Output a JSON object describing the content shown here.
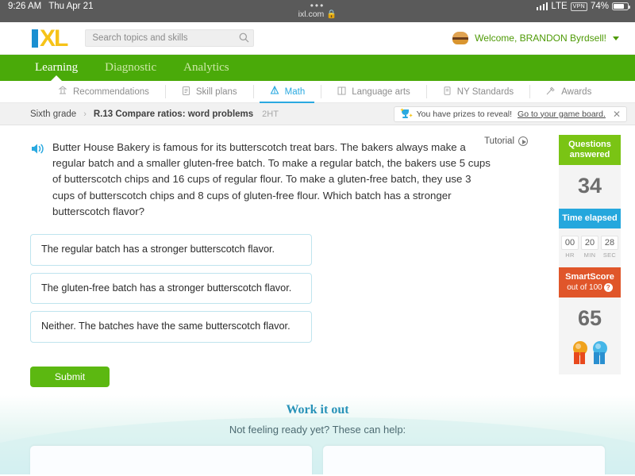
{
  "status_bar": {
    "time": "9:26 AM",
    "date": "Thu Apr 21",
    "url": "ixl.com",
    "lock_icon": "lock-icon",
    "network": "LTE",
    "vpn": "VPN",
    "battery_percent": "74%"
  },
  "header": {
    "logo": {
      "i": "I",
      "x": "X",
      "l": "L"
    },
    "search": {
      "placeholder": "Search topics and skills",
      "value": ""
    },
    "welcome_text": "Welcome, BRANDON Byrdsell!"
  },
  "green_nav": [
    {
      "label": "Learning",
      "active": true
    },
    {
      "label": "Diagnostic",
      "active": false
    },
    {
      "label": "Analytics",
      "active": false
    }
  ],
  "sub_nav": [
    {
      "label": "Recommendations",
      "icon": "recommendations-icon",
      "active": false
    },
    {
      "label": "Skill plans",
      "icon": "clipboard-icon",
      "active": false
    },
    {
      "label": "Math",
      "icon": "math-pyramid-icon",
      "active": true
    },
    {
      "label": "Language arts",
      "icon": "book-icon",
      "active": false
    },
    {
      "label": "NY Standards",
      "icon": "standards-icon",
      "active": false
    },
    {
      "label": "Awards",
      "icon": "awards-icon",
      "active": false
    }
  ],
  "breadcrumb": {
    "grade": "Sixth grade",
    "separator": "›",
    "skill": "R.13 Compare ratios: word problems",
    "code": "2HT"
  },
  "prize_banner": {
    "message": "You have prizes to reveal!",
    "link": "Go to your game board.",
    "close": "✕"
  },
  "tutorial": {
    "label": "Tutorial"
  },
  "question": {
    "text": "Butter House Bakery is famous for its butterscotch treat bars. The bakers always make a regular batch and a smaller gluten-free batch. To make a regular batch, the bakers use 5 cups of butterscotch chips and 16 cups of regular flour. To make a gluten-free batch, they use 3 cups of butterscotch chips and 8 cups of gluten-free flour. Which batch has a stronger butterscotch flavor?",
    "answers": [
      "The regular batch has a stronger butterscotch flavor.",
      "The gluten-free batch has a stronger butterscotch flavor.",
      "Neither. The batches have the same butterscotch flavor."
    ],
    "submit_label": "Submit"
  },
  "rail": {
    "questions_answered": {
      "title": "Questions answered",
      "value": "34"
    },
    "time_elapsed": {
      "title": "Time elapsed",
      "hr": "00",
      "min": "20",
      "sec": "28",
      "hr_label": "HR",
      "min_label": "MIN",
      "sec_label": "SEC"
    },
    "smartscore": {
      "title": "SmartScore",
      "subtitle": "out of 100",
      "value": "65"
    }
  },
  "work_it_out": {
    "title": "Work it out",
    "subtitle": "Not feeling ready yet? These can help:"
  },
  "colors": {
    "green": "#4aaa09",
    "submit_green": "#5cb811",
    "blue": "#2aa9e0",
    "orange": "#e0562a",
    "score_green": "#7ac414"
  }
}
